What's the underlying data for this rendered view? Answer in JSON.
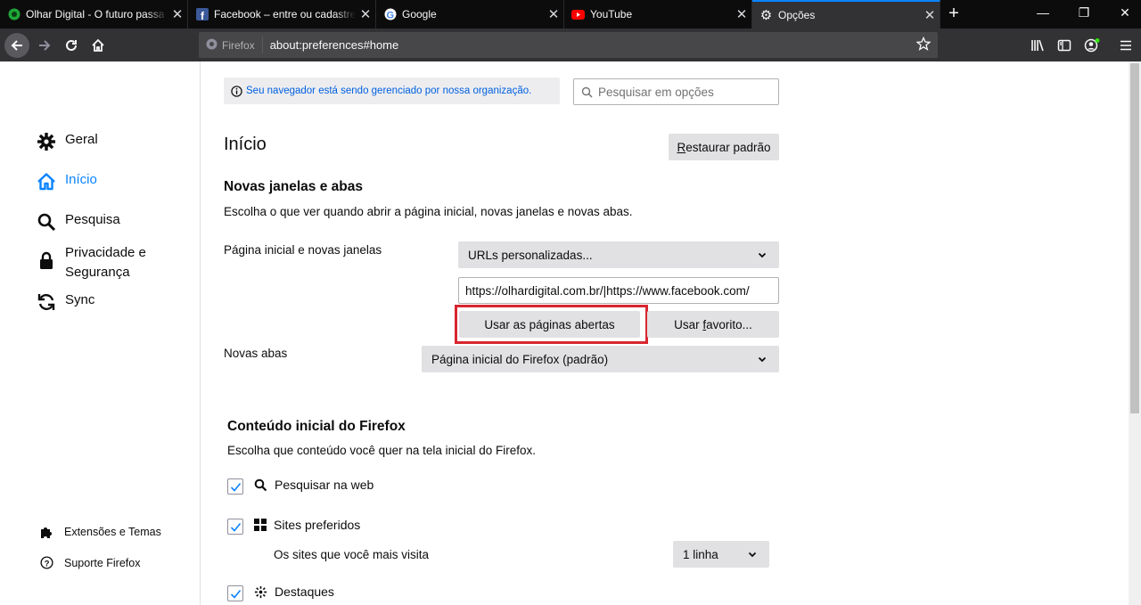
{
  "tabs": [
    {
      "title": "Olhar Digital - O futuro passa p",
      "icon": "olhar-digital-icon",
      "color": "#1fa637"
    },
    {
      "title": "Facebook – entre ou cadastre-se",
      "icon": "facebook-icon",
      "color": "#3b5998"
    },
    {
      "title": "Google",
      "icon": "google-icon",
      "color": "#4285f4"
    },
    {
      "title": "YouTube",
      "icon": "youtube-icon",
      "color": "#ff0000"
    },
    {
      "title": "Opções",
      "icon": "gear-icon",
      "color": "#f9f9fa",
      "active": true
    }
  ],
  "navbar": {
    "identity": "Firefox",
    "url": "about:preferences#home"
  },
  "sidebar": {
    "items": [
      {
        "label": "Geral",
        "icon": "gear-icon"
      },
      {
        "label": "Início",
        "icon": "home-icon",
        "selected": true
      },
      {
        "label": "Pesquisa",
        "icon": "search-icon"
      },
      {
        "label": "Privacidade e Segurança",
        "icon": "lock-icon"
      },
      {
        "label": "Sync",
        "icon": "sync-icon"
      }
    ],
    "footer": [
      {
        "label": "Extensões e Temas",
        "icon": "puzzle-icon"
      },
      {
        "label": "Suporte Firefox",
        "icon": "help-icon"
      }
    ]
  },
  "notice": "Seu navegador está sendo gerenciado por nossa organização.",
  "search": {
    "placeholder": "Pesquisar em opções"
  },
  "page": {
    "title": "Início",
    "restore_pre": "",
    "restore_u": "R",
    "restore_post": "estaurar padrão"
  },
  "section1": {
    "title": "Novas janelas e abas",
    "desc": "Escolha o que ver quando abrir a página inicial, novas janelas e novas abas.",
    "home_label": "Página inicial e novas janelas",
    "home_select": "URLs personalizadas...",
    "home_urls": "https://olhardigital.com.br/|https://www.facebook.com/",
    "use_open": "Usar as páginas abertas",
    "use_bookmark_pre": "Usar ",
    "use_bookmark_u": "f",
    "use_bookmark_post": "avorito...",
    "newtabs_label": "Novas abas",
    "newtabs_select": "Página inicial do Firefox (padrão)"
  },
  "section2": {
    "title": "Conteúdo inicial do Firefox",
    "desc": "Escolha que conteúdo você quer na tela inicial do Firefox.",
    "items": [
      {
        "label": "Pesquisar na web",
        "checked": true,
        "icon": "search-icon"
      },
      {
        "label": "Sites preferidos",
        "checked": true,
        "icon": "grid-icon"
      },
      {
        "label": "Destaques",
        "checked": true,
        "icon": "highlights-icon"
      }
    ],
    "top_sites_desc": "Os sites que você mais visita",
    "rows_select": "1 linha"
  }
}
